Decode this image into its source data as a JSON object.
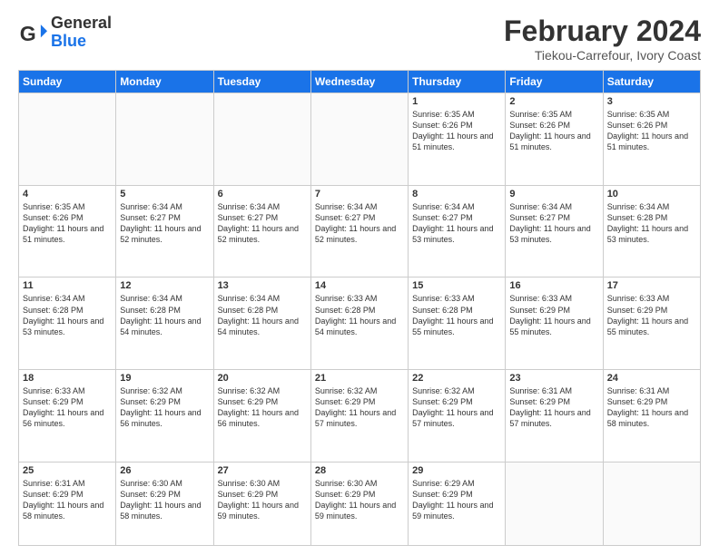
{
  "header": {
    "logo_general": "General",
    "logo_blue": "Blue",
    "month_year": "February 2024",
    "location": "Tiekou-Carrefour, Ivory Coast"
  },
  "weekdays": [
    "Sunday",
    "Monday",
    "Tuesday",
    "Wednesday",
    "Thursday",
    "Friday",
    "Saturday"
  ],
  "weeks": [
    [
      {
        "day": "",
        "info": ""
      },
      {
        "day": "",
        "info": ""
      },
      {
        "day": "",
        "info": ""
      },
      {
        "day": "",
        "info": ""
      },
      {
        "day": "1",
        "info": "Sunrise: 6:35 AM\nSunset: 6:26 PM\nDaylight: 11 hours\nand 51 minutes."
      },
      {
        "day": "2",
        "info": "Sunrise: 6:35 AM\nSunset: 6:26 PM\nDaylight: 11 hours\nand 51 minutes."
      },
      {
        "day": "3",
        "info": "Sunrise: 6:35 AM\nSunset: 6:26 PM\nDaylight: 11 hours\nand 51 minutes."
      }
    ],
    [
      {
        "day": "4",
        "info": "Sunrise: 6:35 AM\nSunset: 6:26 PM\nDaylight: 11 hours\nand 51 minutes."
      },
      {
        "day": "5",
        "info": "Sunrise: 6:34 AM\nSunset: 6:27 PM\nDaylight: 11 hours\nand 52 minutes."
      },
      {
        "day": "6",
        "info": "Sunrise: 6:34 AM\nSunset: 6:27 PM\nDaylight: 11 hours\nand 52 minutes."
      },
      {
        "day": "7",
        "info": "Sunrise: 6:34 AM\nSunset: 6:27 PM\nDaylight: 11 hours\nand 52 minutes."
      },
      {
        "day": "8",
        "info": "Sunrise: 6:34 AM\nSunset: 6:27 PM\nDaylight: 11 hours\nand 53 minutes."
      },
      {
        "day": "9",
        "info": "Sunrise: 6:34 AM\nSunset: 6:27 PM\nDaylight: 11 hours\nand 53 minutes."
      },
      {
        "day": "10",
        "info": "Sunrise: 6:34 AM\nSunset: 6:28 PM\nDaylight: 11 hours\nand 53 minutes."
      }
    ],
    [
      {
        "day": "11",
        "info": "Sunrise: 6:34 AM\nSunset: 6:28 PM\nDaylight: 11 hours\nand 53 minutes."
      },
      {
        "day": "12",
        "info": "Sunrise: 6:34 AM\nSunset: 6:28 PM\nDaylight: 11 hours\nand 54 minutes."
      },
      {
        "day": "13",
        "info": "Sunrise: 6:34 AM\nSunset: 6:28 PM\nDaylight: 11 hours\nand 54 minutes."
      },
      {
        "day": "14",
        "info": "Sunrise: 6:33 AM\nSunset: 6:28 PM\nDaylight: 11 hours\nand 54 minutes."
      },
      {
        "day": "15",
        "info": "Sunrise: 6:33 AM\nSunset: 6:28 PM\nDaylight: 11 hours\nand 55 minutes."
      },
      {
        "day": "16",
        "info": "Sunrise: 6:33 AM\nSunset: 6:29 PM\nDaylight: 11 hours\nand 55 minutes."
      },
      {
        "day": "17",
        "info": "Sunrise: 6:33 AM\nSunset: 6:29 PM\nDaylight: 11 hours\nand 55 minutes."
      }
    ],
    [
      {
        "day": "18",
        "info": "Sunrise: 6:33 AM\nSunset: 6:29 PM\nDaylight: 11 hours\nand 56 minutes."
      },
      {
        "day": "19",
        "info": "Sunrise: 6:32 AM\nSunset: 6:29 PM\nDaylight: 11 hours\nand 56 minutes."
      },
      {
        "day": "20",
        "info": "Sunrise: 6:32 AM\nSunset: 6:29 PM\nDaylight: 11 hours\nand 56 minutes."
      },
      {
        "day": "21",
        "info": "Sunrise: 6:32 AM\nSunset: 6:29 PM\nDaylight: 11 hours\nand 57 minutes."
      },
      {
        "day": "22",
        "info": "Sunrise: 6:32 AM\nSunset: 6:29 PM\nDaylight: 11 hours\nand 57 minutes."
      },
      {
        "day": "23",
        "info": "Sunrise: 6:31 AM\nSunset: 6:29 PM\nDaylight: 11 hours\nand 57 minutes."
      },
      {
        "day": "24",
        "info": "Sunrise: 6:31 AM\nSunset: 6:29 PM\nDaylight: 11 hours\nand 58 minutes."
      }
    ],
    [
      {
        "day": "25",
        "info": "Sunrise: 6:31 AM\nSunset: 6:29 PM\nDaylight: 11 hours\nand 58 minutes."
      },
      {
        "day": "26",
        "info": "Sunrise: 6:30 AM\nSunset: 6:29 PM\nDaylight: 11 hours\nand 58 minutes."
      },
      {
        "day": "27",
        "info": "Sunrise: 6:30 AM\nSunset: 6:29 PM\nDaylight: 11 hours\nand 59 minutes."
      },
      {
        "day": "28",
        "info": "Sunrise: 6:30 AM\nSunset: 6:29 PM\nDaylight: 11 hours\nand 59 minutes."
      },
      {
        "day": "29",
        "info": "Sunrise: 6:29 AM\nSunset: 6:29 PM\nDaylight: 11 hours\nand 59 minutes."
      },
      {
        "day": "",
        "info": ""
      },
      {
        "day": "",
        "info": ""
      }
    ]
  ]
}
